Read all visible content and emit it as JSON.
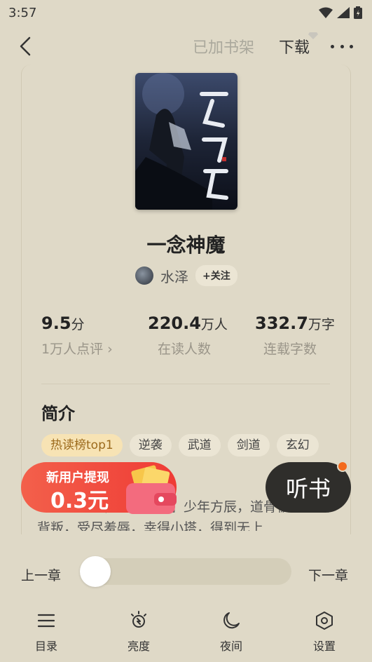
{
  "status_bar": {
    "time": "3:57"
  },
  "header": {
    "shelf_label": "已加书架",
    "download_label": "下载"
  },
  "book": {
    "title": "一念神魔",
    "author": "水泽",
    "follow_label": "+关注"
  },
  "stats": [
    {
      "value": "9.5",
      "unit": "分",
      "label": "1万人点评 ›"
    },
    {
      "value": "220.4",
      "unit": "万人",
      "label": "在读人数"
    },
    {
      "value": "332.7",
      "unit": "万字",
      "label": "连载字数"
    }
  ],
  "intro": {
    "heading": "简介",
    "tags": [
      "热读榜top1",
      "逆袭",
      "武道",
      "剑道",
      "玄幻"
    ],
    "text": "【热血玄幻，爽文节奏】少年方辰，道骨被夺遭受背叛，受尽羞辱，幸得小塔，得到无上"
  },
  "promo": {
    "line1": "新用户提现",
    "line2": "0.3元"
  },
  "listen_label": "听书",
  "reader": {
    "prev_chapter": "上一章",
    "next_chapter": "下一章",
    "progress": 0.0
  },
  "bottom_nav": [
    "目录",
    "亮度",
    "夜间",
    "设置"
  ],
  "colors": {
    "background": "#dfd9c7",
    "promo": "#ef3b35",
    "accent_dot": "#f36a1c"
  }
}
